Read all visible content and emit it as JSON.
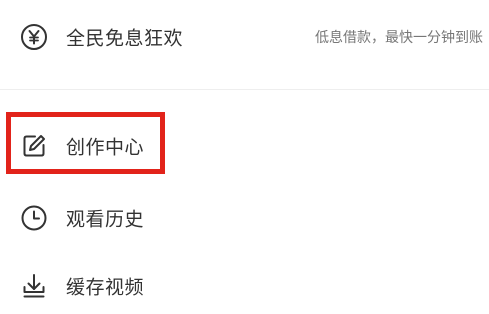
{
  "menu": {
    "finance": {
      "icon": "yen-circle-icon",
      "label": "全民免息狂欢",
      "subtitle": "低息借款，最快一分钟到账"
    },
    "items": [
      {
        "icon": "edit-icon",
        "label": "创作中心"
      },
      {
        "icon": "clock-icon",
        "label": "观看历史"
      },
      {
        "icon": "download-icon",
        "label": "缓存视频"
      }
    ]
  },
  "colors": {
    "text": "#333333",
    "subtext": "#777777",
    "highlight": "#e2231a",
    "divider": "#eeeeee"
  }
}
